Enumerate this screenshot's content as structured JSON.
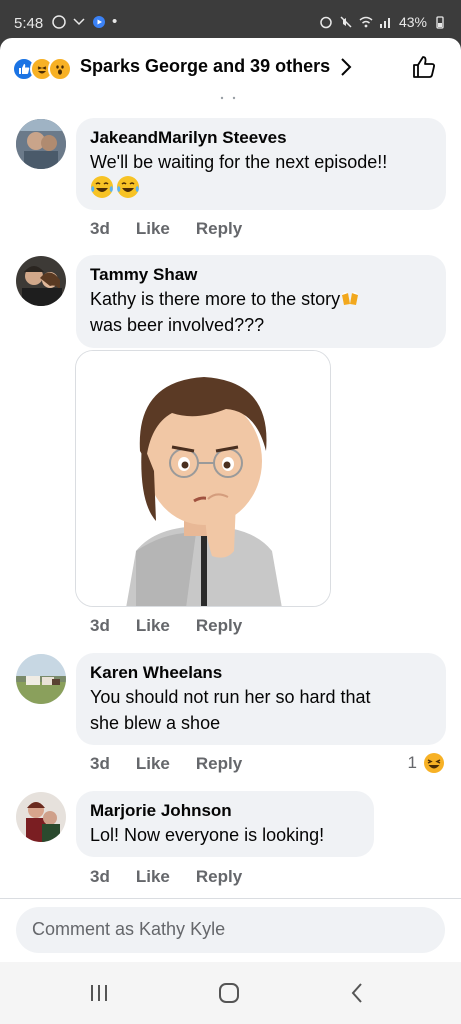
{
  "status": {
    "time": "5:48",
    "battery": "43%"
  },
  "header": {
    "reactions": [
      "like-icon",
      "haha-icon",
      "wow-icon"
    ],
    "title": "Sparks George and 39 others"
  },
  "comments": [
    {
      "author": "JakeandMarilyn Steeves",
      "text": "We'll be waiting for the next episode!!",
      "time": "3d",
      "like": "Like",
      "reply": "Reply"
    },
    {
      "author": "Tammy Shaw",
      "text1": "Kathy is there more to the story",
      "text2": "was beer involved???",
      "time": "3d",
      "like": "Like",
      "reply": "Reply"
    },
    {
      "author": "Karen Wheelans",
      "text1": "You should not run her so hard that",
      "text2": "she blew a shoe",
      "time": "3d",
      "like": "Like",
      "reply": "Reply",
      "reaction_count": "1"
    },
    {
      "author": "Marjorie Johnson",
      "text": "Lol!  Now everyone is looking!",
      "time": "3d",
      "like": "Like",
      "reply": "Reply"
    }
  ],
  "composer": {
    "placeholder": "Comment as Kathy Kyle"
  },
  "colors": {
    "brand": "#1b74e4",
    "bubble": "#f0f2f5",
    "meta": "#65676b"
  }
}
